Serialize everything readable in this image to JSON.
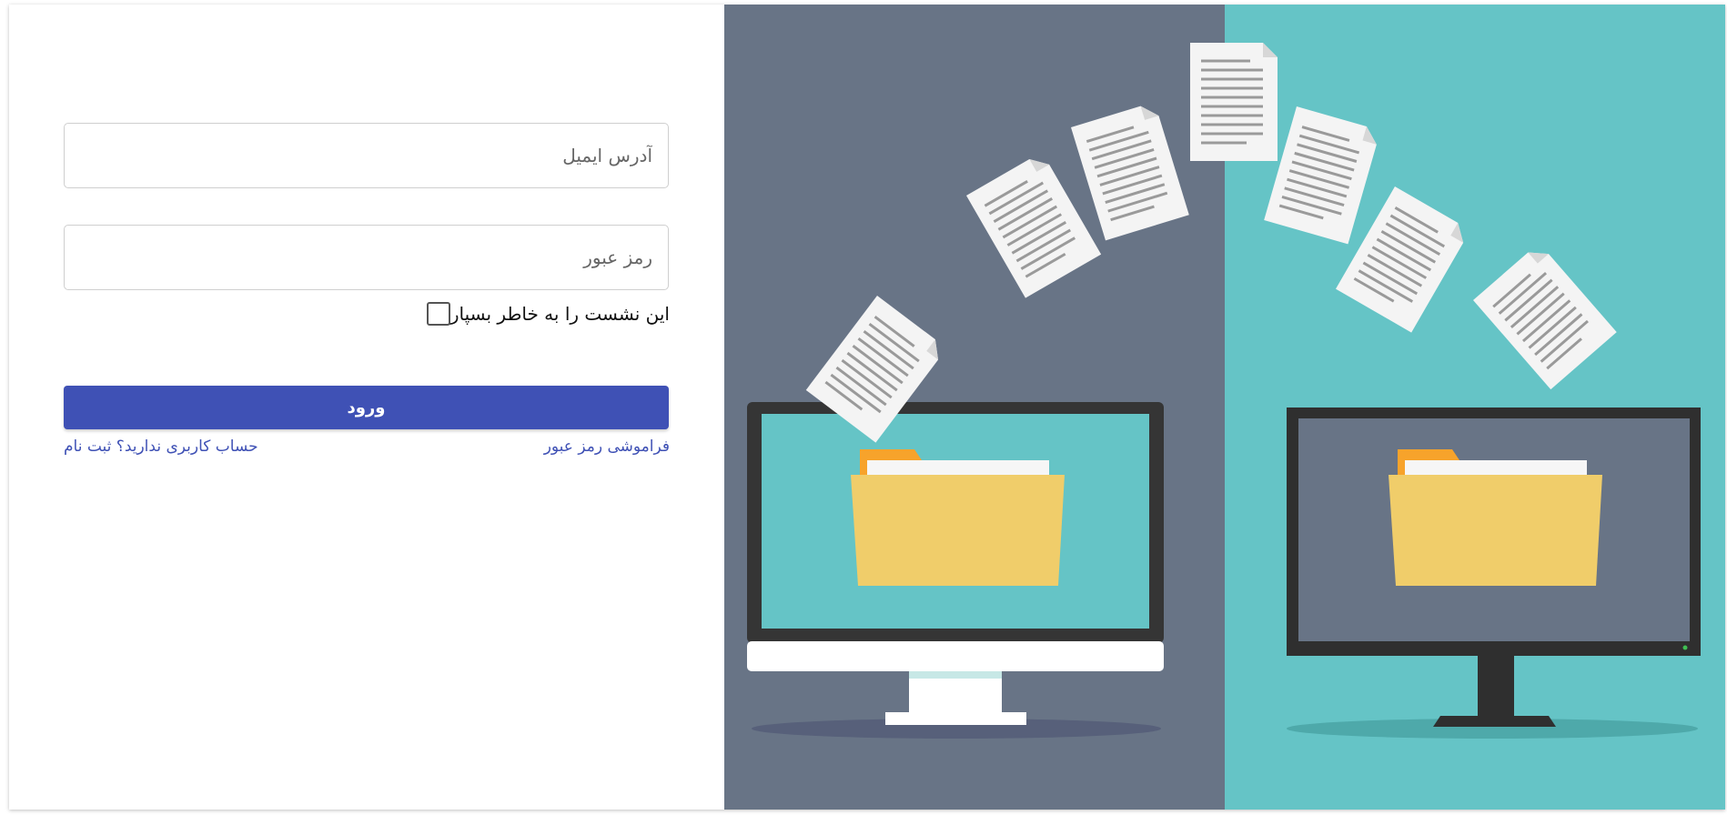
{
  "login_form": {
    "email_placeholder": "آدرس ایمیل",
    "password_placeholder": "رمز عبور",
    "remember_label": "این نشست را به خاطر بسپار",
    "remember_checked": false,
    "submit_label": "ورود",
    "forgot_password_link": "فراموشی رمز عبور",
    "register_link": "حساب کاربری ندارید؟ ثبت نام"
  },
  "colors": {
    "primary": "#3f51b5",
    "illustration_left_bg": "#687486",
    "illustration_right_bg": "#65c4c6",
    "folder": "#f0cd6a"
  },
  "illustration": {
    "icons": [
      "monitor-icon",
      "folder-icon",
      "document-icon",
      "transfer-illustration"
    ]
  }
}
